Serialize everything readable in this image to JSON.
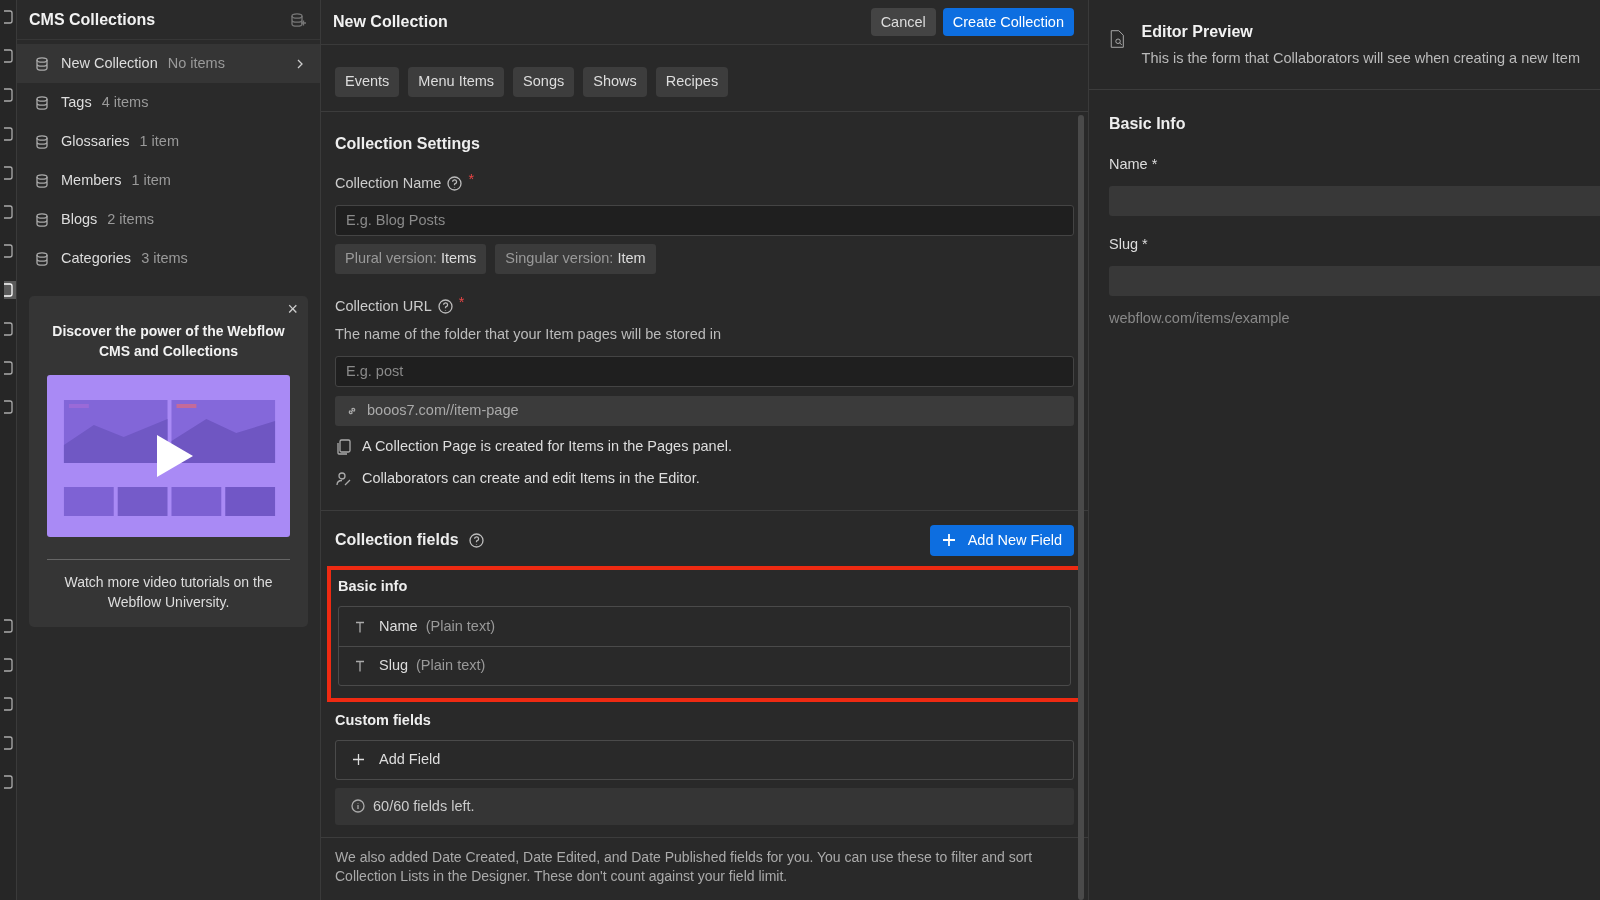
{
  "icon_rail": [
    {
      "selected": false
    },
    {
      "selected": false
    },
    {
      "selected": false
    },
    {
      "selected": false
    },
    {
      "selected": false
    },
    {
      "selected": false
    },
    {
      "selected": false
    },
    {
      "selected": true
    },
    {
      "selected": false
    },
    {
      "selected": false
    },
    {
      "selected": false
    },
    {
      "selected": false
    },
    {
      "selected": false
    },
    {
      "selected": false
    },
    {
      "selected": false
    },
    {
      "selected": false
    }
  ],
  "sidebar": {
    "title": "CMS Collections",
    "items": [
      {
        "name": "New Collection",
        "count": "No items",
        "selected": true
      },
      {
        "name": "Tags",
        "count": "4 items",
        "selected": false
      },
      {
        "name": "Glossaries",
        "count": "1 item",
        "selected": false
      },
      {
        "name": "Members",
        "count": "1 item",
        "selected": false
      },
      {
        "name": "Blogs",
        "count": "2 items",
        "selected": false
      },
      {
        "name": "Categories",
        "count": "3 items",
        "selected": false
      }
    ],
    "promo": {
      "close": "×",
      "title": "Discover the power of the Webflow CMS and Collections",
      "footer": "Watch more video tutorials on the",
      "link": "Webflow University",
      "after_link": "."
    }
  },
  "header": {
    "title": "New Collection",
    "buttons": [
      {
        "label": "Cancel",
        "kind": "secondary"
      },
      {
        "label": "Create Collection",
        "kind": "primary"
      }
    ]
  },
  "templates": [
    "Events",
    "Menu Items",
    "Songs",
    "Shows",
    "Recipes"
  ],
  "settings": {
    "title": "Collection Settings",
    "name_label": "Collection Name",
    "name_required": "*",
    "name_placeholder": "E.g. Blog Posts",
    "versions": [
      {
        "label": "Plural version:",
        "value": "Items"
      },
      {
        "label": "Singular version:",
        "value": "Item"
      }
    ],
    "url_label": "Collection URL",
    "url_required": "*",
    "url_hint": "The name of the folder that your Item pages will be stored in",
    "url_placeholder": "E.g. post",
    "url_preview": "booos7.com//item-page",
    "notes": [
      {
        "kind": "pages",
        "text": "A Collection Page is created for Items in the Pages panel."
      },
      {
        "kind": "collaborators",
        "text": "Collaborators can create and edit Items in the Editor."
      }
    ]
  },
  "fields": {
    "title": "Collection fields",
    "add_button": "Add New Field",
    "basic": {
      "title": "Basic info",
      "highlighted": true,
      "items": [
        {
          "name": "Name",
          "type": "(Plain text)"
        },
        {
          "name": "Slug",
          "type": "(Plain text)"
        }
      ]
    },
    "custom": {
      "title": "Custom fields",
      "add": "Add Field"
    },
    "limit": "60/60 fields left.",
    "footnote": "We also added Date Created, Date Edited, and Date Published fields for you. You can use these to filter and sort Collection Lists in the Designer. These don't count against your field limit."
  },
  "preview": {
    "title": "Editor Preview",
    "subtitle": "This is the form that Collaborators will see when creating a new Item",
    "section": "Basic Info",
    "inputs": [
      {
        "label": "Name *"
      },
      {
        "label": "Slug *"
      }
    ],
    "slug_hint": "webflow.com/items/example"
  }
}
